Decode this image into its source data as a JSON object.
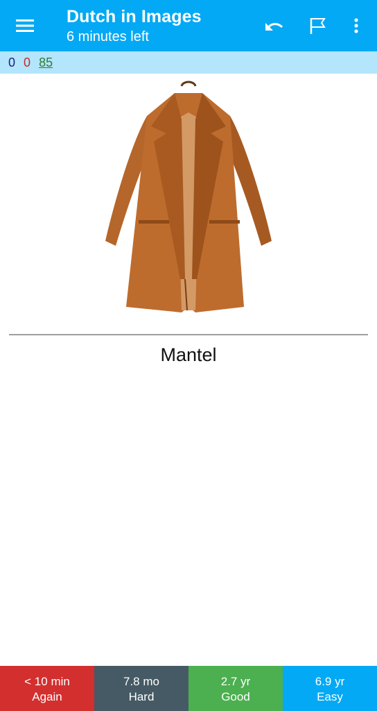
{
  "toolbar": {
    "title": "Dutch in Images",
    "subtitle": "6 minutes left",
    "menu_icon": "hamburger-menu-icon",
    "undo_icon": "undo-icon",
    "flag_icon": "flag-icon",
    "more_icon": "more-vert-icon",
    "color": "#03a9f4"
  },
  "counts": {
    "new": "0",
    "learning": "0",
    "review": "85"
  },
  "card": {
    "image": "brown-coat-image",
    "answer": "Mantel"
  },
  "answer_buttons": [
    {
      "interval": "< 10 min",
      "label": "Again",
      "color": "#d32f2f"
    },
    {
      "interval": "7.8 mo",
      "label": "Hard",
      "color": "#455a64"
    },
    {
      "interval": "2.7 yr",
      "label": "Good",
      "color": "#4caf50"
    },
    {
      "interval": "6.9 yr",
      "label": "Easy",
      "color": "#03a9f4"
    }
  ]
}
